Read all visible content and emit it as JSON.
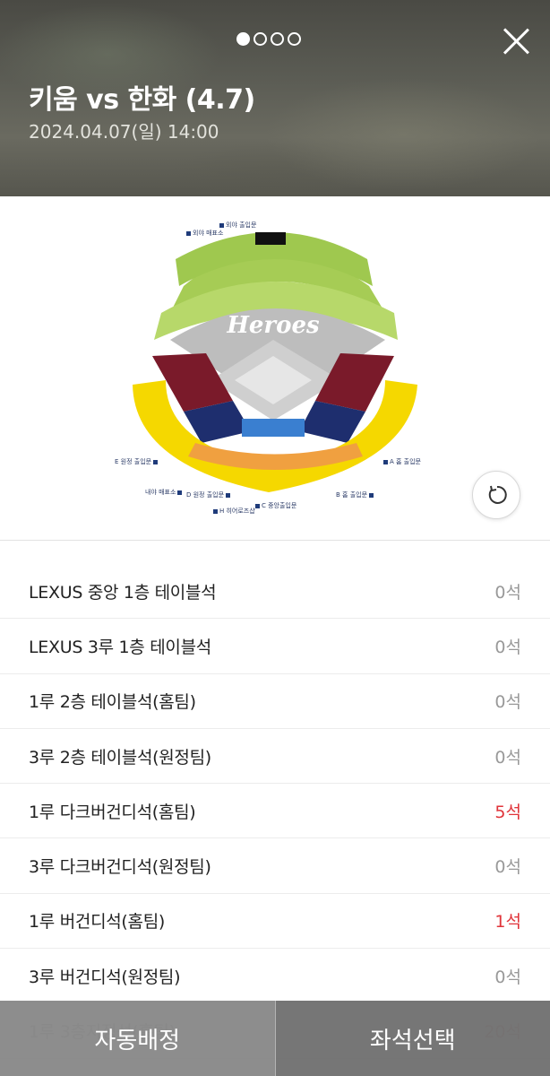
{
  "header": {
    "title": "키움 vs 한화 (4.7)",
    "datetime": "2024.04.07(일) 14:00",
    "page_indicator": {
      "current": 1,
      "total": 4
    }
  },
  "map": {
    "logo_text": "Heroes",
    "gates": {
      "outfield_gate": "외야 출입문",
      "outfield_ticket": "외야 매표소",
      "gate_e": "E 원정 출입문",
      "gate_a": "A 홈 출입문",
      "infield_ticket": "내야 매표소",
      "gate_d": "D 원정 출입문",
      "gate_c": "C 중앙출입문",
      "gate_b": "B 홈 출입문",
      "gate_h": "H 히어로즈샵"
    }
  },
  "seats": [
    {
      "name": "LEXUS 중앙 1층 테이블석",
      "count": "0석",
      "available": false
    },
    {
      "name": "LEXUS 3루 1층 테이블석",
      "count": "0석",
      "available": false
    },
    {
      "name": "1루 2층 테이블석(홈팀)",
      "count": "0석",
      "available": false
    },
    {
      "name": "3루 2층 테이블석(원정팀)",
      "count": "0석",
      "available": false
    },
    {
      "name": "1루 다크버건디석(홈팀)",
      "count": "5석",
      "available": true
    },
    {
      "name": "3루 다크버건디석(원정팀)",
      "count": "0석",
      "available": false
    },
    {
      "name": "1루 버건디석(홈팀)",
      "count": "1석",
      "available": true
    },
    {
      "name": "3루 버건디석(원정팀)",
      "count": "0석",
      "available": false
    },
    {
      "name": "1루 3층지정석(홈팀)",
      "count": "20석",
      "available": true
    }
  ],
  "bottom": {
    "auto_assign": "자동배정",
    "select_seat": "좌석선택"
  },
  "colors": {
    "available": "#e0343a",
    "unavailable": "#999999",
    "outfield": "#a6cc55",
    "yellow": "#f5d800",
    "burgundy": "#7a1a2a",
    "navy": "#1e2e6e",
    "blue": "#3a7fd0"
  }
}
